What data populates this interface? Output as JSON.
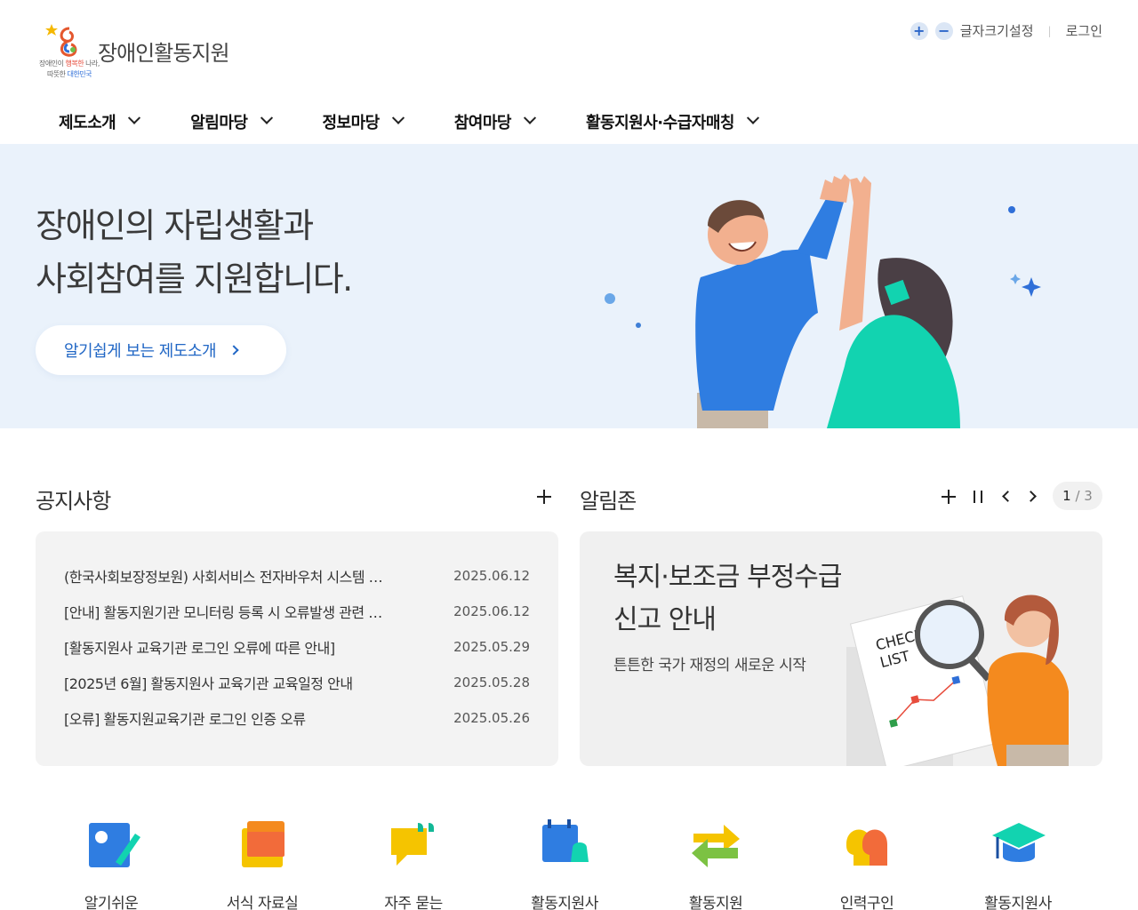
{
  "header": {
    "logo_title": "장애인활동지원",
    "logo_sub_1a": "장애인이 ",
    "logo_sub_1b": "행복한",
    "logo_sub_1c": " 나라,",
    "logo_sub_2a": "따뜻한 ",
    "logo_sub_2b": "대한민국",
    "zoom_in": "+",
    "zoom_out": "−",
    "font_setting": "글자크기설정",
    "login": "로그인"
  },
  "nav": {
    "items": [
      {
        "label": "제도소개"
      },
      {
        "label": "알림마당"
      },
      {
        "label": "정보마당"
      },
      {
        "label": "참여마당"
      },
      {
        "label": "활동지원사·수급자매칭"
      }
    ]
  },
  "hero": {
    "title_line1": "장애인의 자립생활과",
    "title_line2": "사회참여를 지원합니다.",
    "button": "알기쉽게 보는 제도소개"
  },
  "notice": {
    "title": "공지사항",
    "rows": [
      {
        "title": "(한국사회보장정보원) 사회서비스 전자바우처 시스템 점검 안내",
        "date": "2025.06.12"
      },
      {
        "title": "[안내] 활동지원기관 모니터링 등록 시 오류발생 관련 안내",
        "date": "2025.06.12"
      },
      {
        "title": "[활동지원사 교육기관 로그인 오류에 따른 안내]",
        "date": "2025.05.29"
      },
      {
        "title": "[2025년 6월] 활동지원사 교육기관 교육일정 안내",
        "date": "2025.05.28"
      },
      {
        "title": "[오류] 활동지원교육기관 로그인 인증 오류",
        "date": "2025.05.26"
      }
    ]
  },
  "alarm": {
    "title": "알림존",
    "page_current": "1",
    "page_sep": " / ",
    "page_total": "3",
    "card_title_1": "복지·보조금 부정수급",
    "card_title_2": "신고 안내",
    "card_sub": "튼튼한 국가 재정의 새로운 시작",
    "art_text_1": "CHECK",
    "art_text_2": "LIST"
  },
  "quick": [
    {
      "label": "알기쉬운",
      "icon": "edit-icon"
    },
    {
      "label": "서식 자료실",
      "icon": "folder-icon"
    },
    {
      "label": "자주 묻는",
      "icon": "speech-bubble-icon"
    },
    {
      "label": "활동지원사",
      "icon": "calendar-bell-icon"
    },
    {
      "label": "활동지원",
      "icon": "exchange-arrows-icon"
    },
    {
      "label": "인력구인",
      "icon": "people-icon"
    },
    {
      "label": "활동지원사",
      "icon": "graduation-cap-icon"
    }
  ],
  "colors": {
    "accent": "#2167c5",
    "hero_bg": "#eaf2fb",
    "box_bg": "#f3f3f3"
  }
}
